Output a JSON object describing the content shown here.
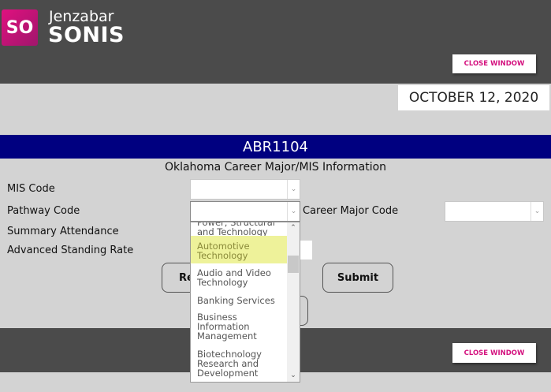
{
  "header": {
    "logo_text": "SO",
    "brand_line1": "Jenzabar",
    "brand_line2": "SONIS",
    "close_label": "CLOSE WINDOW"
  },
  "date": "OCTOBER 12, 2020",
  "title": "ABR1104",
  "subtitle": "Oklahoma Career Major/MIS Information",
  "form": {
    "mis_code": "MIS Code",
    "pathway_code": "Pathway Code",
    "career_major_code": "Career Major Code",
    "summary_attendance": "Summary Attendance",
    "advanced_standing_rate": "Advanced Standing Rate"
  },
  "buttons": {
    "reset_partial": "Re",
    "submit": "Submit"
  },
  "dropdown": {
    "options": [
      "Power, Structural and Technology",
      "Automotive Technology",
      "Audio and Video Technology",
      "Banking Services",
      "Business Information Management",
      "Biotechnology Research and Development"
    ],
    "highlighted": "Automotive Technology",
    "highlight_color": "#eef29a"
  },
  "footer": {
    "close_label": "CLOSE WINDOW"
  },
  "colors": {
    "brand": "#d4127f",
    "title_bar": "#000080",
    "header": "#4b4b4b"
  }
}
